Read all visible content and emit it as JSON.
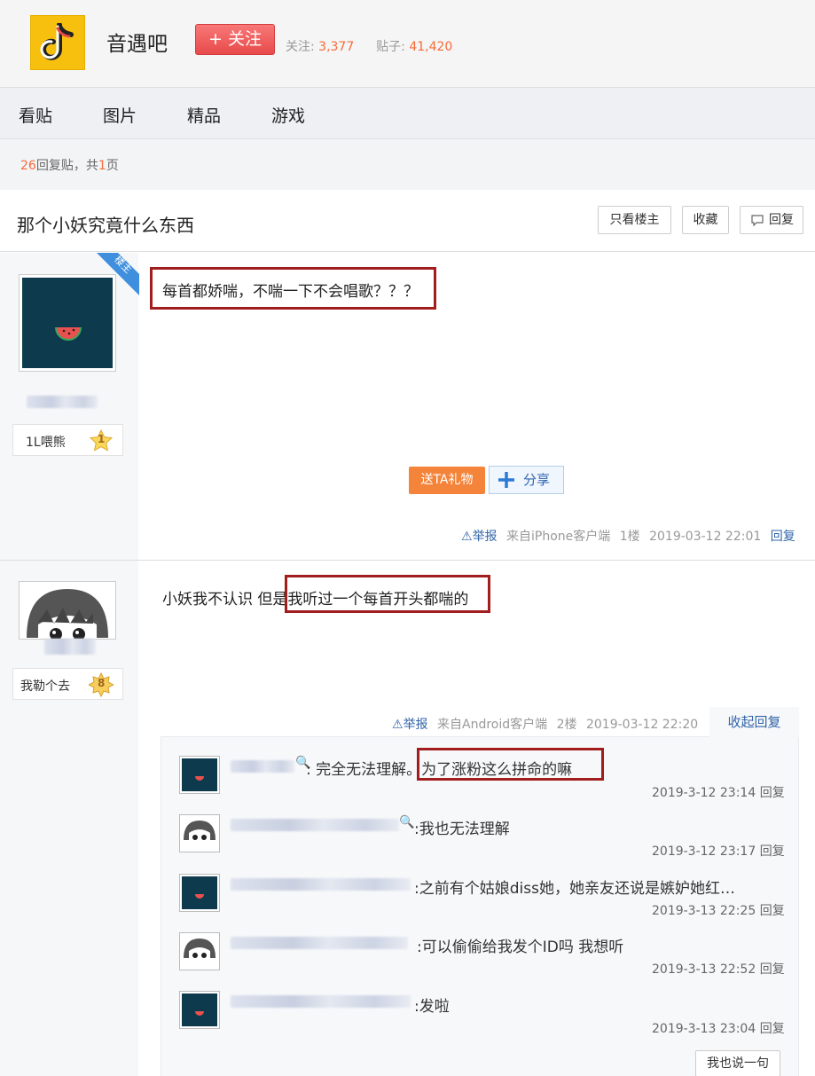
{
  "header": {
    "forum_name": "音遇吧",
    "follow_label": "+ 关注",
    "followers_label": "关注:",
    "followers_count": "3,377",
    "posts_label": "贴子:",
    "posts_count": "41,420"
  },
  "nav": {
    "items": [
      "看贴",
      "图片",
      "精品",
      "游戏"
    ]
  },
  "reply_info": {
    "count": "26",
    "text_mid": "回复贴，共",
    "pages": "1",
    "text_end": "页"
  },
  "thread": {
    "title": "那个小妖究竟什么东西",
    "buttons": {
      "only_op": "只看楼主",
      "favorite": "收藏",
      "reply": "回复"
    }
  },
  "posts": [
    {
      "badge": "楼主",
      "level_name": "1L喂熊",
      "level": "1",
      "content": "每首都娇喘，不喘一下不会唱歌？？？",
      "gift_label": "送TA礼物",
      "share_label": "分享",
      "report": "举报",
      "source": "来自iPhone客户端",
      "floor": "1楼",
      "time": "2019-03-12 22:01",
      "reply_label": "回复"
    },
    {
      "level_name": "我勒个去",
      "level": "8",
      "content": "小妖我不认识 但是我听过一个每首开头都喘的",
      "report": "举报",
      "source": "来自Android客户端",
      "floor": "2楼",
      "time": "2019-03-12 22:20",
      "collapse_label": "收起回复"
    }
  ],
  "comments": [
    {
      "text": ": 完全无法理解。为了涨粉这么拼命的嘛",
      "time": "2019-3-12 23:14",
      "reply": "回复"
    },
    {
      "text": ":我也无法理解",
      "time": "2019-3-12 23:17",
      "reply": "回复"
    },
    {
      "text": ":之前有个姑娘diss她，她亲友还说是嫉妒她红…",
      "time": "2019-3-13 22:25",
      "reply": "回复"
    },
    {
      "text": ":可以偷偷给我发个ID吗 我想听",
      "time": "2019-3-13 22:52",
      "reply": "回复"
    },
    {
      "text": ":发啦",
      "time": "2019-3-13 23:04",
      "reply": "回复"
    }
  ],
  "say_button": "我也说一句",
  "colors": {
    "accent_orange": "#f56b3a",
    "link_blue": "#3064a8",
    "highlight_red": "#a21d1d",
    "follow_red": "#e84a4a",
    "logo_yellow": "#f7c00e"
  }
}
